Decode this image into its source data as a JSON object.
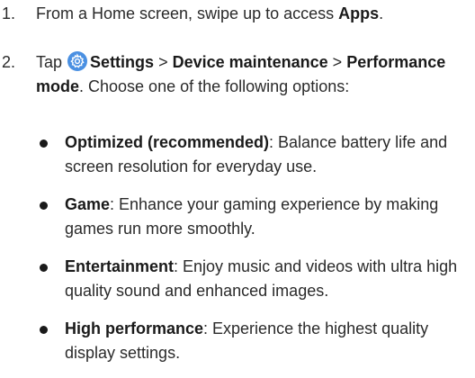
{
  "steps": [
    {
      "number": "1.",
      "prefix": "From a Home screen, swipe up to access ",
      "bold": "Apps",
      "suffix": "."
    },
    {
      "number": "2.",
      "tap": "Tap",
      "icon": "settings-gear-icon",
      "settings": "Settings",
      "sep1": " > ",
      "device_maintenance": "Device maintenance",
      "sep2": " > ",
      "performance_mode": "Performance mode",
      "suffix": ". Choose one of the following options:"
    }
  ],
  "options": [
    {
      "title": "Optimized (recommended)",
      "desc": ": Balance battery life and screen resolution for everyday use."
    },
    {
      "title": "Game",
      "desc": ": Enhance your gaming experience by making games run more smoothly."
    },
    {
      "title": "Entertainment",
      "desc": ": Enjoy music and videos with ultra high quality sound and enhanced images."
    },
    {
      "title": "High performance",
      "desc": ": Experience the highest quality display settings."
    }
  ],
  "colors": {
    "icon_bg": "#4a90e2",
    "text": "#2a2a2a"
  }
}
